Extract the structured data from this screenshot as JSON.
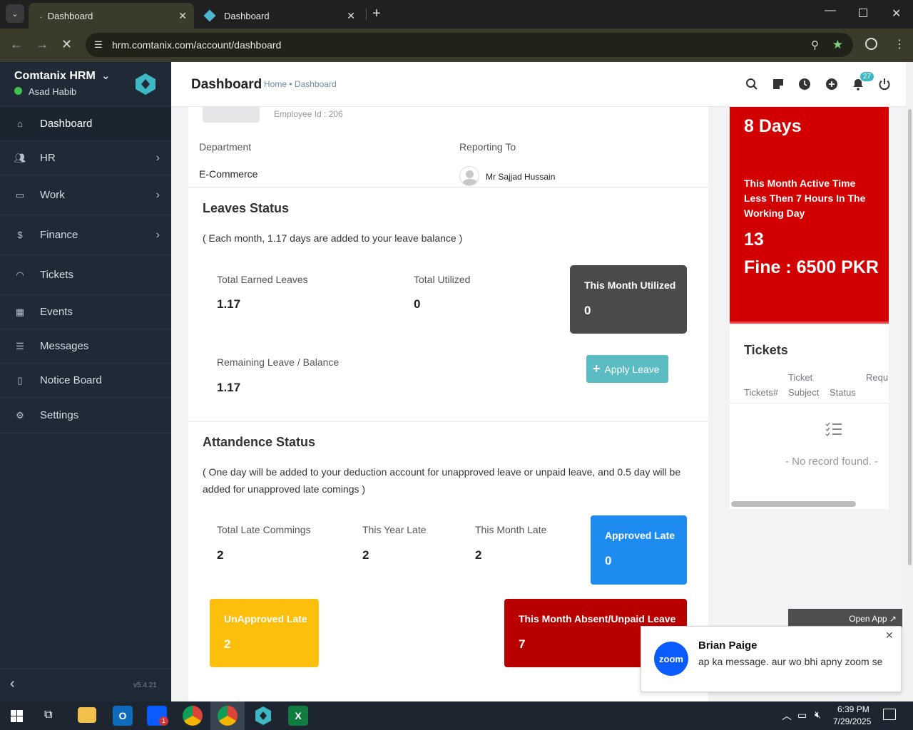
{
  "browser": {
    "tabs": [
      {
        "label": "Dashboard"
      },
      {
        "label": "Dashboard"
      }
    ],
    "url": "hrm.comtanix.com/account/dashboard"
  },
  "sidebar": {
    "app_name": "Comtanix HRM",
    "user_name": "Asad Habib",
    "items": [
      {
        "label": "Dashboard",
        "icon": "home-icon"
      },
      {
        "label": "HR",
        "icon": "users-icon"
      },
      {
        "label": "Work",
        "icon": "briefcase-icon"
      },
      {
        "label": "Finance",
        "icon": "dollar-icon"
      },
      {
        "label": "Tickets",
        "icon": "headset-icon"
      },
      {
        "label": "Events",
        "icon": "calendar-icon"
      },
      {
        "label": "Messages",
        "icon": "message-icon"
      },
      {
        "label": "Notice Board",
        "icon": "clipboard-icon"
      },
      {
        "label": "Settings",
        "icon": "gear-icon"
      }
    ],
    "version": "v5.4.21"
  },
  "header": {
    "title": "Dashboard",
    "breadcrumb_home": "Home",
    "breadcrumb_sep": "•",
    "breadcrumb_current": "Dashboard",
    "notification_count": "27"
  },
  "profile": {
    "employee_id": "Employee Id : 206",
    "department_label": "Department",
    "department_value": "E-Commerce",
    "reporting_label": "Reporting To",
    "reporting_value": "Mr Sajjad Hussain"
  },
  "leaves": {
    "title": "Leaves Status",
    "note": "( Each month, 1.17 days are added to your leave balance )",
    "total_earned_label": "Total Earned Leaves",
    "total_earned_value": "1.17",
    "total_utilized_label": "Total Utilized",
    "total_utilized_value": "0",
    "month_utilized_label": "This Month Utilized",
    "month_utilized_value": "0",
    "remaining_label": "Remaining Leave / Balance",
    "remaining_value": "1.17",
    "apply_button": "Apply Leave"
  },
  "attendance": {
    "title": "Attandence Status",
    "note": "( One day will be added to your deduction account for unapproved leave or unpaid leave, and 0.5 day will be added for unapproved late comings )",
    "total_late_label": "Total Late Commings",
    "total_late_value": "2",
    "year_late_label": "This Year Late",
    "year_late_value": "2",
    "month_late_label": "This Month Late",
    "month_late_value": "2",
    "approved_late_label": "Approved Late",
    "approved_late_value": "0",
    "unapproved_late_label": "UnApproved Late",
    "unapproved_late_value": "2",
    "absent_label": "This Month Absent/Unpaid Leave",
    "absent_value": "7"
  },
  "active_time": {
    "days": "8 Days",
    "text": "This Month Active Time Less Then 7 Hours In The Working Day",
    "count": "13",
    "fine": "Fine : 6500 PKR"
  },
  "tickets": {
    "title": "Tickets",
    "col1": "Tickets#",
    "col2_line1": "Ticket",
    "col2_line2": "Subject",
    "col3": "Status",
    "col4": "Requ",
    "empty": "- No record found. -"
  },
  "zoom_popup": {
    "open_app": "Open App ↗",
    "logo": "zoom",
    "sender": "Brian Paige",
    "message": "ap ka message. aur wo bhi apny zoom se"
  },
  "taskbar": {
    "time": "6:39 PM",
    "date": "7/29/2025",
    "zoom_badge": "1"
  },
  "colors": {
    "sidebar_bg": "#1f2a36",
    "brand_teal": "#3fb8c6",
    "apply_btn": "#5bbcc3",
    "approved_blue": "#1e8bf0",
    "unapproved_yellow": "#fbbf0c",
    "absent_red": "#b80000",
    "fine_red": "#d20000",
    "month_utilized_dark": "#4a4a4a"
  }
}
